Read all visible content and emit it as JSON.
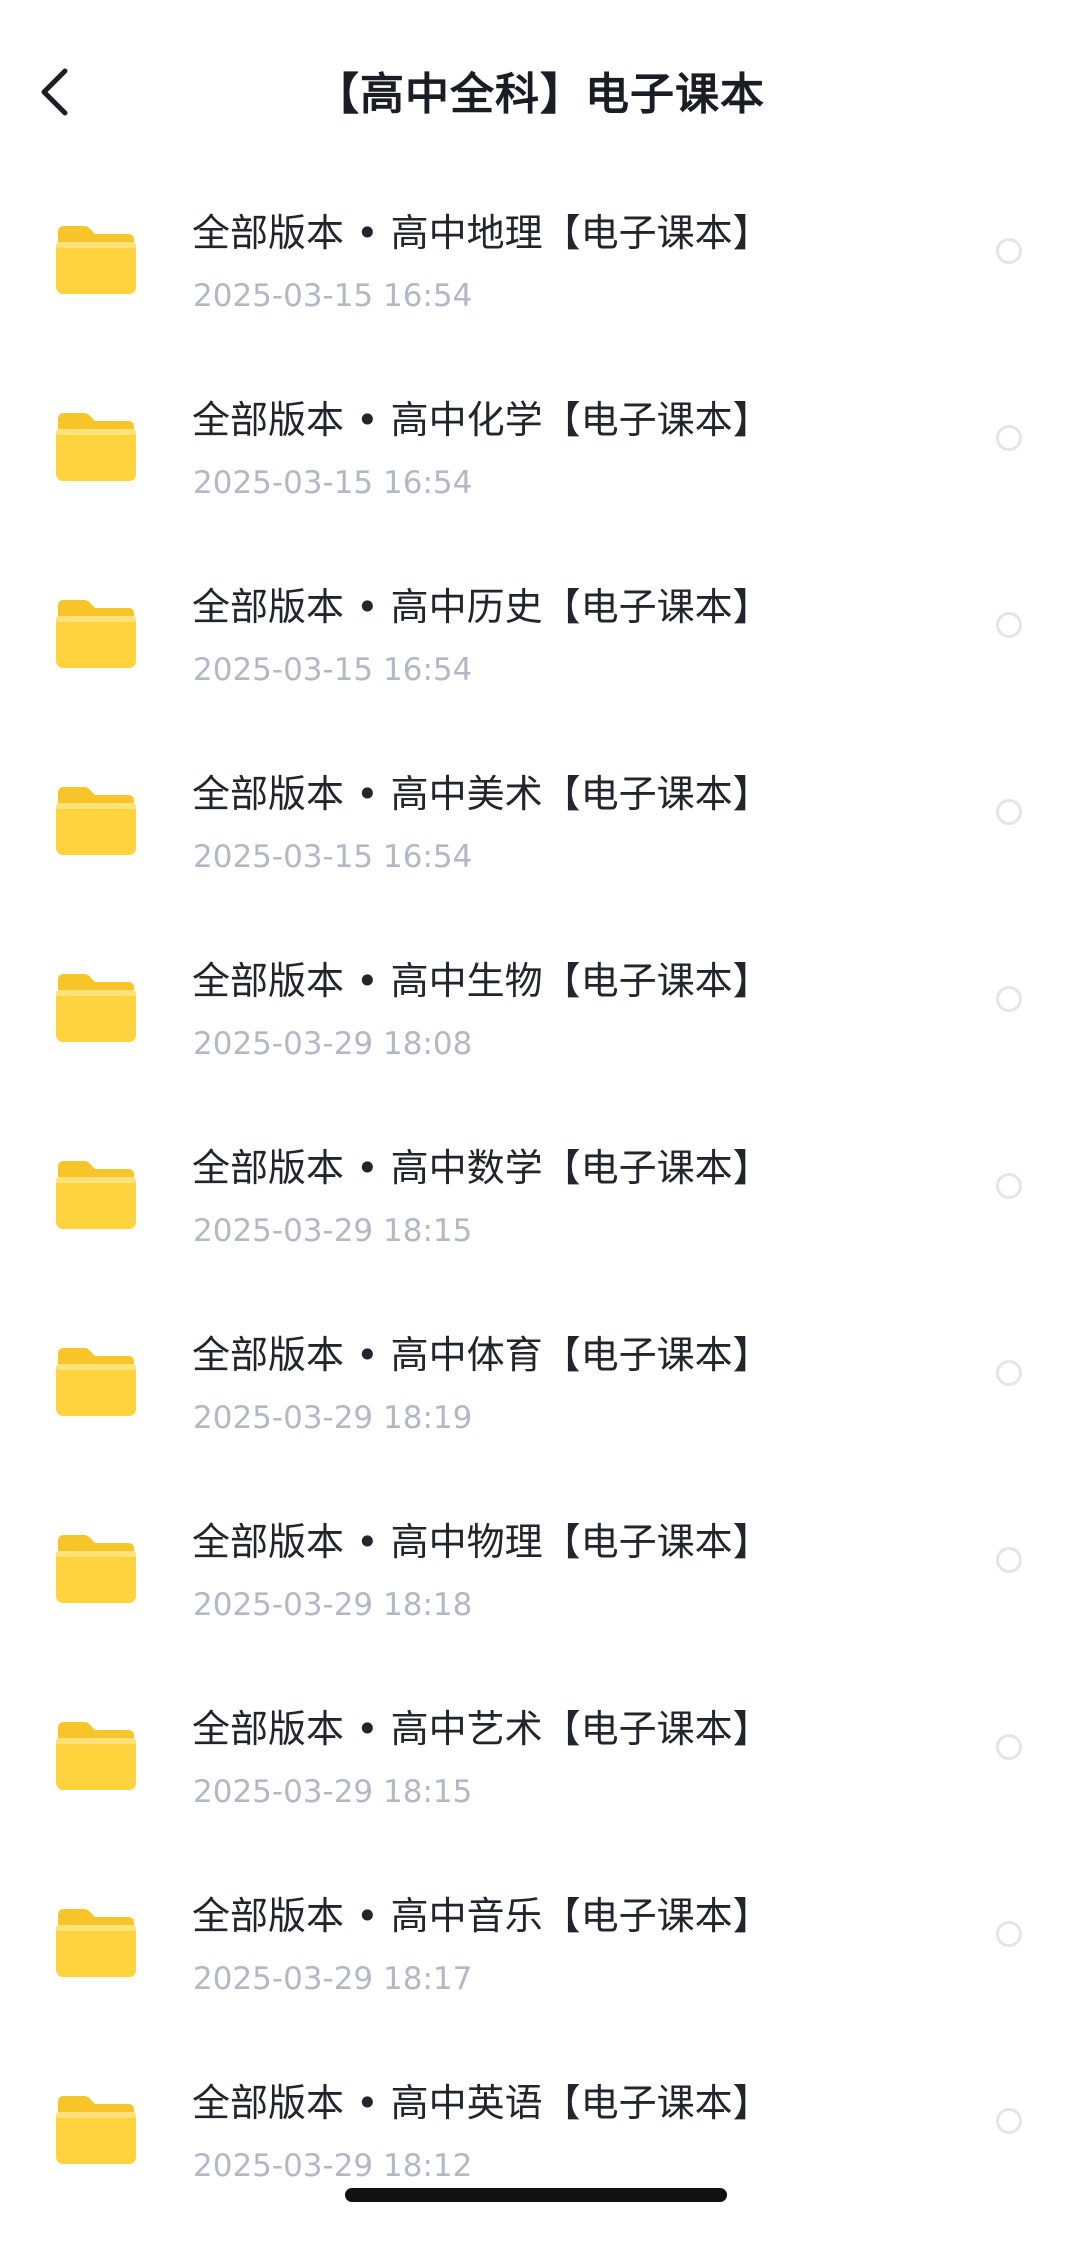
{
  "header": {
    "title": "【高中全科】电子课本"
  },
  "icons": {
    "back": "chevron-left-icon",
    "folder": "folder-icon",
    "select": "radio-circle-icon"
  },
  "colors": {
    "folder_body": "#FFD33D",
    "folder_tab": "#F7C52A",
    "date_text": "#B3B8C4",
    "radio_border": "#E3E5EA"
  },
  "items": [
    {
      "name": "全部版本 • 高中地理【电子课本】",
      "date": "2025-03-15 16:54"
    },
    {
      "name": "全部版本 • 高中化学【电子课本】",
      "date": "2025-03-15 16:54"
    },
    {
      "name": "全部版本 • 高中历史【电子课本】",
      "date": "2025-03-15 16:54"
    },
    {
      "name": "全部版本 • 高中美术【电子课本】",
      "date": "2025-03-15 16:54"
    },
    {
      "name": "全部版本 • 高中生物【电子课本】",
      "date": "2025-03-29 18:08"
    },
    {
      "name": "全部版本 • 高中数学【电子课本】",
      "date": "2025-03-29 18:15"
    },
    {
      "name": "全部版本 • 高中体育【电子课本】",
      "date": "2025-03-29 18:19"
    },
    {
      "name": "全部版本 • 高中物理【电子课本】",
      "date": "2025-03-29 18:18"
    },
    {
      "name": "全部版本 • 高中艺术【电子课本】",
      "date": "2025-03-29 18:15"
    },
    {
      "name": "全部版本 • 高中音乐【电子课本】",
      "date": "2025-03-29 18:17"
    },
    {
      "name": "全部版本 • 高中英语【电子课本】",
      "date": "2025-03-29 18:12"
    }
  ]
}
